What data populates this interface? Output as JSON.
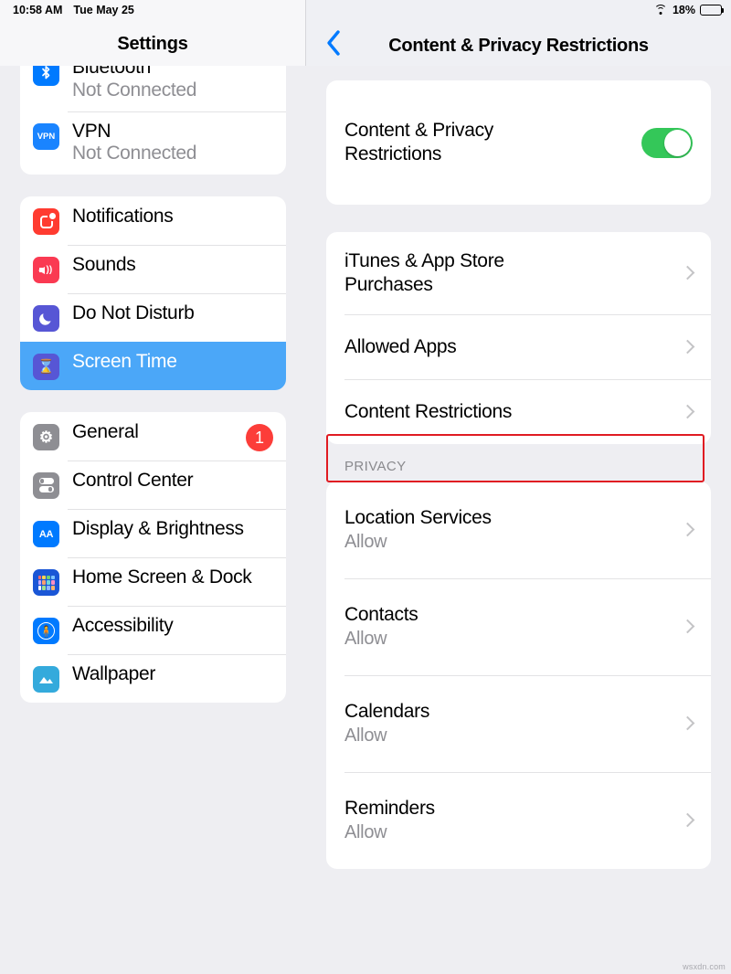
{
  "status_bar": {
    "time": "10:58 AM",
    "date": "Tue May 25",
    "battery_percent": "18%",
    "battery_level": 18,
    "wifi_icon": "wifi-icon",
    "battery_icon": "battery-icon"
  },
  "sidebar": {
    "title": "Settings",
    "groups": [
      {
        "name": "connectivity",
        "items": [
          {
            "label": "Bluetooth",
            "value": "Not Connected",
            "icon": "bluetooth-icon",
            "badge": null,
            "selected": false
          },
          {
            "label": "VPN",
            "value": "Not Connected",
            "icon": "vpn-icon",
            "badge": null,
            "selected": false
          }
        ]
      },
      {
        "name": "alerts",
        "items": [
          {
            "label": "Notifications",
            "value": null,
            "icon": "notifications-icon",
            "badge": null,
            "selected": false
          },
          {
            "label": "Sounds",
            "value": null,
            "icon": "sounds-icon",
            "badge": null,
            "selected": false
          },
          {
            "label": "Do Not Disturb",
            "value": null,
            "icon": "moon-icon",
            "badge": null,
            "selected": false
          },
          {
            "label": "Screen Time",
            "value": null,
            "icon": "hourglass-icon",
            "badge": null,
            "selected": true
          }
        ]
      },
      {
        "name": "system",
        "items": [
          {
            "label": "General",
            "value": null,
            "icon": "gear-icon",
            "badge": "1",
            "selected": false
          },
          {
            "label": "Control Center",
            "value": null,
            "icon": "control-center-icon",
            "badge": null,
            "selected": false
          },
          {
            "label": "Display & Brightness",
            "value": null,
            "icon": "display-brightness-icon",
            "badge": null,
            "selected": false
          },
          {
            "label": "Home Screen & Dock",
            "value": null,
            "icon": "home-screen-icon",
            "badge": null,
            "selected": false
          },
          {
            "label": "Accessibility",
            "value": null,
            "icon": "accessibility-icon",
            "badge": null,
            "selected": false
          },
          {
            "label": "Wallpaper",
            "value": null,
            "icon": "wallpaper-icon",
            "badge": null,
            "selected": false
          }
        ]
      }
    ]
  },
  "detail": {
    "back_label": "back-chevron",
    "title": "Content & Privacy Restrictions",
    "master_toggle": {
      "label": "Content & Privacy Restrictions",
      "state": "on"
    },
    "restrictions": [
      {
        "label": "iTunes & App Store Purchases",
        "value": null,
        "highlighted": false
      },
      {
        "label": "Allowed Apps",
        "value": null,
        "highlighted": false
      },
      {
        "label": "Content Restrictions",
        "value": null,
        "highlighted": true
      }
    ],
    "privacy_section_header": "PRIVACY",
    "privacy": [
      {
        "label": "Location Services",
        "value": "Allow"
      },
      {
        "label": "Contacts",
        "value": "Allow"
      },
      {
        "label": "Calendars",
        "value": "Allow"
      },
      {
        "label": "Reminders",
        "value": "Allow"
      }
    ]
  },
  "watermark": "wsxdn.com",
  "colors": {
    "accent_blue": "#007aff",
    "selection_blue": "#4ba7f8",
    "toggle_green": "#34c759",
    "badge_red": "#fc3d39",
    "highlight_red": "#e01b22",
    "page_background": "#eeeef2",
    "card_background": "#ffffff",
    "secondary_text": "#8e8e93"
  }
}
